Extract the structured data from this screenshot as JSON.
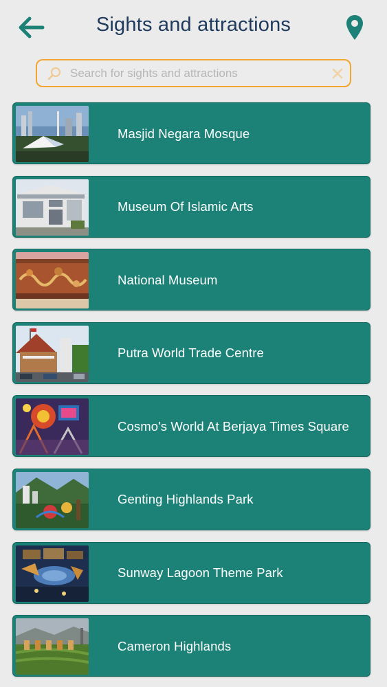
{
  "header": {
    "title": "Sights and attractions",
    "back_icon": "arrow-left-icon",
    "map_icon": "map-pin-icon"
  },
  "search": {
    "placeholder": "Search for sights and attractions",
    "value": "",
    "search_icon": "magnifier-icon",
    "clear_icon": "clear-x-icon"
  },
  "colors": {
    "accent": "#1c8277",
    "title": "#1f3a5b",
    "search_border": "#f2a52f",
    "background": "#ebebeb"
  },
  "attractions": [
    {
      "name": "Masjid Negara Mosque",
      "thumbnail": "mosque-photo"
    },
    {
      "name": "Museum Of Islamic Arts",
      "thumbnail": "museum-building-photo"
    },
    {
      "name": "National Museum",
      "thumbnail": "mural-photo"
    },
    {
      "name": "Putra World Trade Centre",
      "thumbnail": "trade-centre-photo"
    },
    {
      "name": "Cosmo's World At Berjaya Times Square",
      "thumbnail": "theme-park-ride-photo"
    },
    {
      "name": "Genting Highlands Park",
      "thumbnail": "highland-resort-photo"
    },
    {
      "name": "Sunway Lagoon Theme Park",
      "thumbnail": "lagoon-night-photo"
    },
    {
      "name": "Cameron Highlands",
      "thumbnail": "tea-plantation-photo"
    }
  ]
}
